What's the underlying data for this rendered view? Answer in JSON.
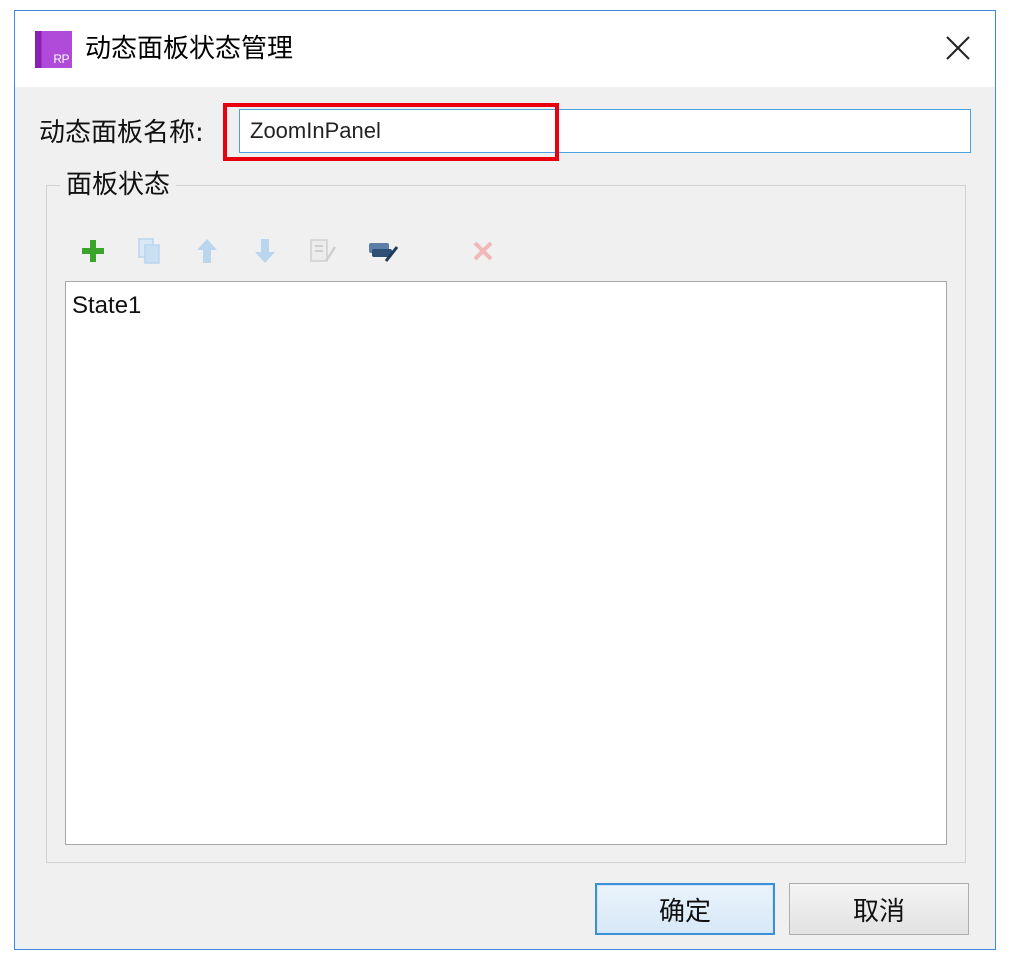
{
  "window": {
    "title": "动态面板状态管理",
    "app_icon_text": "RP",
    "close_icon": "close-icon"
  },
  "name_field": {
    "label": "动态面板名称:",
    "value": "ZoomInPanel"
  },
  "states_group": {
    "legend": "面板状态",
    "toolbar": [
      {
        "icon": "add-icon",
        "enabled": true,
        "color": "#3aa52a"
      },
      {
        "icon": "duplicate-icon",
        "enabled": false,
        "color": "#b9d6ee"
      },
      {
        "icon": "move-up-icon",
        "enabled": false,
        "color": "#b9d6ee"
      },
      {
        "icon": "move-down-icon",
        "enabled": false,
        "color": "#b9d6ee"
      },
      {
        "icon": "edit-state-icon",
        "enabled": false,
        "color": "#cfcfcf"
      },
      {
        "icon": "edit-all-states-icon",
        "enabled": true,
        "color": "#2f5f8f"
      },
      {
        "icon": "delete-icon",
        "enabled": false,
        "color": "#f2b7b7"
      }
    ],
    "states": [
      "State1"
    ]
  },
  "buttons": {
    "ok": "确定",
    "cancel": "取消"
  },
  "colors": {
    "highlight": "#e8000e",
    "accent": "#3b8fd6",
    "dialog_bg": "#f0f0f0"
  }
}
